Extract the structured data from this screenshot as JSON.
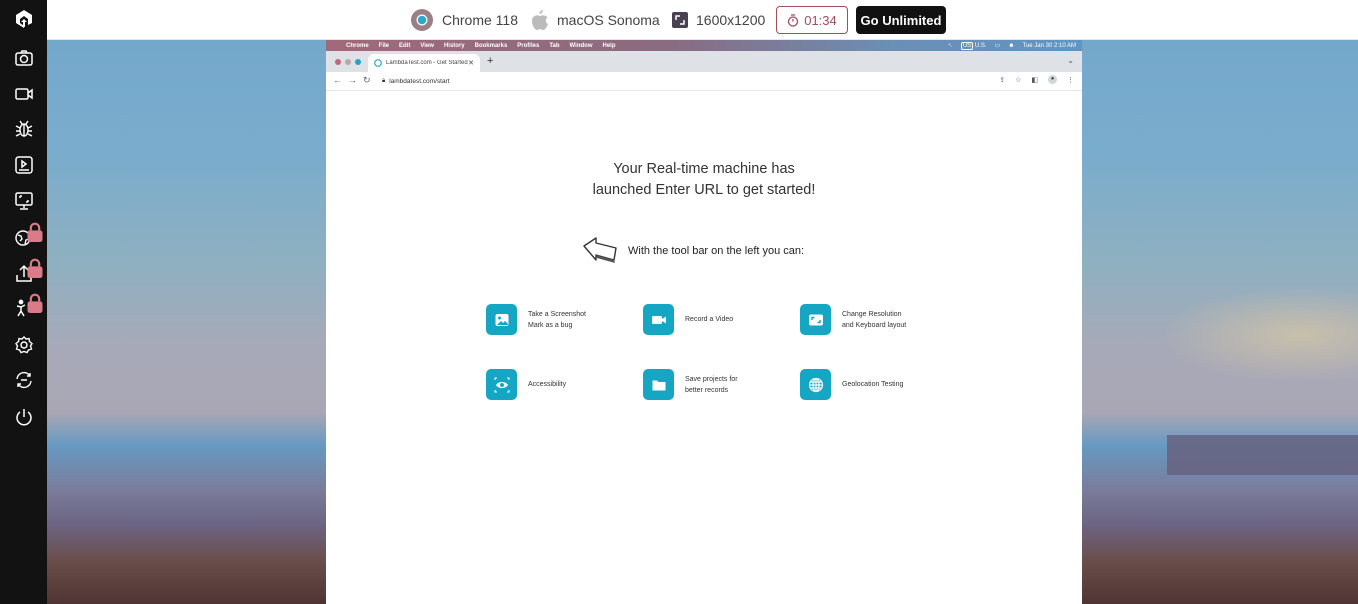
{
  "sidebar": {
    "items": [
      {
        "name": "logo",
        "icon": "lambdatest-logo-icon"
      },
      {
        "name": "screenshot",
        "icon": "camera-icon"
      },
      {
        "name": "record-video",
        "icon": "video-camera-icon"
      },
      {
        "name": "bug",
        "icon": "bug-icon"
      },
      {
        "name": "test-logs",
        "icon": "play-screen-icon"
      },
      {
        "name": "resolution",
        "icon": "monitor-resize-icon"
      },
      {
        "name": "geolocation",
        "icon": "globe-icon",
        "locked": true
      },
      {
        "name": "upload",
        "icon": "upload-icon",
        "locked": true
      },
      {
        "name": "accessibility",
        "icon": "accessibility-person-icon",
        "locked": true
      },
      {
        "name": "settings",
        "icon": "gear-icon"
      },
      {
        "name": "switch",
        "icon": "switch-arrows-icon"
      },
      {
        "name": "end-session",
        "icon": "power-icon"
      }
    ]
  },
  "topbar": {
    "browser": "Chrome 118",
    "os": "macOS Sonoma",
    "resolution": "1600x1200",
    "timer": "01:34",
    "cta": "Go Unlimited",
    "colors": {
      "timer": "#a14d5a",
      "cta_bg": "#111111"
    }
  },
  "mac_menubar": {
    "items": [
      "Chrome",
      "File",
      "Edit",
      "View",
      "History",
      "Bookmarks",
      "Profiles",
      "Tab",
      "Window",
      "Help"
    ],
    "input_source": "U.S.",
    "input_badge": "US",
    "clock": "Tue Jan 30  2:10 AM"
  },
  "browser": {
    "tab_title": "LambdaTest.com - Get Started",
    "url": "lambdatest.com/start"
  },
  "page": {
    "headline_line1": "Your Real-time machine has",
    "headline_line2": "launched Enter URL to get started!",
    "hint": "With the tool bar on the left you can:",
    "accent": "#14a6c3",
    "features": [
      {
        "icon": "image-icon",
        "line1": "Take a Screenshot",
        "line2": "Mark as a bug"
      },
      {
        "icon": "video-icon",
        "line1": "Record a Video",
        "line2": ""
      },
      {
        "icon": "resolution-icon",
        "line1": "Change Resolution",
        "line2": "and Keyboard layout"
      },
      {
        "icon": "eye-icon",
        "line1": "Accessibility",
        "line2": ""
      },
      {
        "icon": "folder-icon",
        "line1": "Save projects for",
        "line2": "better records"
      },
      {
        "icon": "globe-icon",
        "line1": "Geolocation Testing",
        "line2": ""
      }
    ]
  }
}
